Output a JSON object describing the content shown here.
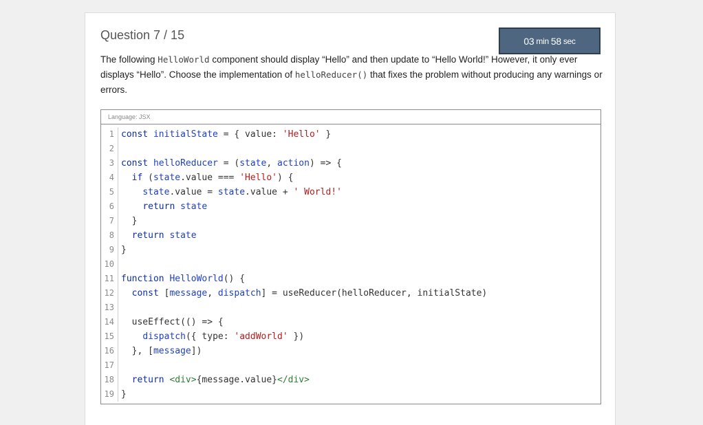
{
  "question": {
    "label": "Question 7 / 15"
  },
  "timer": {
    "minutes": "03",
    "min_unit": "min",
    "seconds": "58",
    "sec_unit": "sec"
  },
  "prompt": {
    "part1": "The following ",
    "component": "HelloWorld",
    "part2": " component should display “Hello” and then update to “Hello World!” However, it only ever displays “Hello”. Choose the implementation of ",
    "reducer": "helloReducer()",
    "part3": " that fixes the problem without producing any warnings or errors."
  },
  "code": {
    "language_label": "Language: JSX",
    "lines": [
      {
        "n": "1",
        "tokens": [
          [
            "kw",
            "const "
          ],
          [
            "fn",
            "initialState"
          ],
          [
            "plain",
            " = { value: "
          ],
          [
            "str",
            "'Hello'"
          ],
          [
            "plain",
            " }"
          ]
        ]
      },
      {
        "n": "2",
        "tokens": []
      },
      {
        "n": "3",
        "tokens": [
          [
            "kw",
            "const "
          ],
          [
            "fn",
            "helloReducer"
          ],
          [
            "plain",
            " = ("
          ],
          [
            "fn",
            "state"
          ],
          [
            "plain",
            ", "
          ],
          [
            "fn",
            "action"
          ],
          [
            "plain",
            ") => {"
          ]
        ]
      },
      {
        "n": "4",
        "tokens": [
          [
            "plain",
            "  "
          ],
          [
            "kw",
            "if"
          ],
          [
            "plain",
            " ("
          ],
          [
            "fn",
            "state"
          ],
          [
            "plain",
            ".value === "
          ],
          [
            "str",
            "'Hello'"
          ],
          [
            "plain",
            ") {"
          ]
        ]
      },
      {
        "n": "5",
        "tokens": [
          [
            "plain",
            "    "
          ],
          [
            "fn",
            "state"
          ],
          [
            "plain",
            ".value = "
          ],
          [
            "fn",
            "state"
          ],
          [
            "plain",
            ".value + "
          ],
          [
            "str",
            "' World!'"
          ]
        ]
      },
      {
        "n": "6",
        "tokens": [
          [
            "plain",
            "    "
          ],
          [
            "kw",
            "return "
          ],
          [
            "fn",
            "state"
          ]
        ]
      },
      {
        "n": "7",
        "tokens": [
          [
            "plain",
            "  }"
          ]
        ]
      },
      {
        "n": "8",
        "tokens": [
          [
            "plain",
            "  "
          ],
          [
            "kw",
            "return "
          ],
          [
            "fn",
            "state"
          ]
        ]
      },
      {
        "n": "9",
        "tokens": [
          [
            "plain",
            "}"
          ]
        ]
      },
      {
        "n": "10",
        "tokens": []
      },
      {
        "n": "11",
        "tokens": [
          [
            "kw",
            "function "
          ],
          [
            "fn",
            "HelloWorld"
          ],
          [
            "plain",
            "() {"
          ]
        ]
      },
      {
        "n": "12",
        "tokens": [
          [
            "plain",
            "  "
          ],
          [
            "kw",
            "const "
          ],
          [
            "plain",
            "["
          ],
          [
            "fn",
            "message"
          ],
          [
            "plain",
            ", "
          ],
          [
            "fn",
            "dispatch"
          ],
          [
            "plain",
            "] = useReducer(helloReducer, initialState)"
          ]
        ]
      },
      {
        "n": "13",
        "tokens": []
      },
      {
        "n": "14",
        "tokens": [
          [
            "plain",
            "  useEffect(() => {"
          ]
        ]
      },
      {
        "n": "15",
        "tokens": [
          [
            "plain",
            "    "
          ],
          [
            "fn",
            "dispatch"
          ],
          [
            "plain",
            "({ type: "
          ],
          [
            "str",
            "'addWorld'"
          ],
          [
            "plain",
            " })"
          ]
        ]
      },
      {
        "n": "16",
        "tokens": [
          [
            "plain",
            "  }, ["
          ],
          [
            "fn",
            "message"
          ],
          [
            "plain",
            "])"
          ]
        ]
      },
      {
        "n": "17",
        "tokens": []
      },
      {
        "n": "18",
        "tokens": [
          [
            "plain",
            "  "
          ],
          [
            "kw",
            "return "
          ],
          [
            "tag",
            "<div>"
          ],
          [
            "plain",
            "{message.value}"
          ],
          [
            "tag",
            "</div>"
          ]
        ]
      },
      {
        "n": "19",
        "tokens": [
          [
            "plain",
            "}"
          ]
        ]
      }
    ]
  }
}
